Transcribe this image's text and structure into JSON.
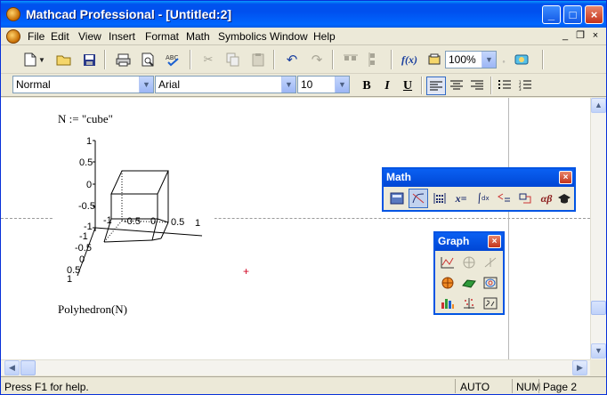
{
  "window": {
    "title": "Mathcad Professional - [Untitled:2]"
  },
  "menu": [
    "File",
    "Edit",
    "View",
    "Insert",
    "Format",
    "Math",
    "Symbolics",
    "Window",
    "Help"
  ],
  "toolbar": {
    "zoom": "100%"
  },
  "format": {
    "style": "Normal",
    "font": "Arial",
    "size": "10",
    "bold": "B",
    "italic": "I",
    "underline": "U"
  },
  "worksheet": {
    "definition": "N := \"cube\"",
    "call": "Polyhedron(N)",
    "plot_ticks": {
      "z": [
        "1",
        "0.5",
        "0",
        "-0.5",
        "-1"
      ],
      "x": [
        "-1",
        "-0.5",
        "0",
        "0.5",
        "1"
      ],
      "y": [
        "-1",
        "-0.5",
        "0",
        "0.5",
        "1"
      ]
    }
  },
  "palettes": {
    "math": {
      "title": "Math",
      "close": "×",
      "buttons": [
        "calculator-icon",
        "graph-icon",
        "matrix-icon",
        "x=",
        "calculus-icon",
        "boolean-icon",
        "programming-icon",
        "αβ",
        "symbolic-icon"
      ]
    },
    "graph": {
      "title": "Graph",
      "close": "×"
    }
  },
  "status": {
    "help": "Press F1 for help.",
    "mode": "AUTO",
    "num": "NUM",
    "page": "Page 2"
  },
  "icons": {
    "title_min": "_",
    "title_max": "□",
    "title_close": "×",
    "fx": "f(x)"
  }
}
